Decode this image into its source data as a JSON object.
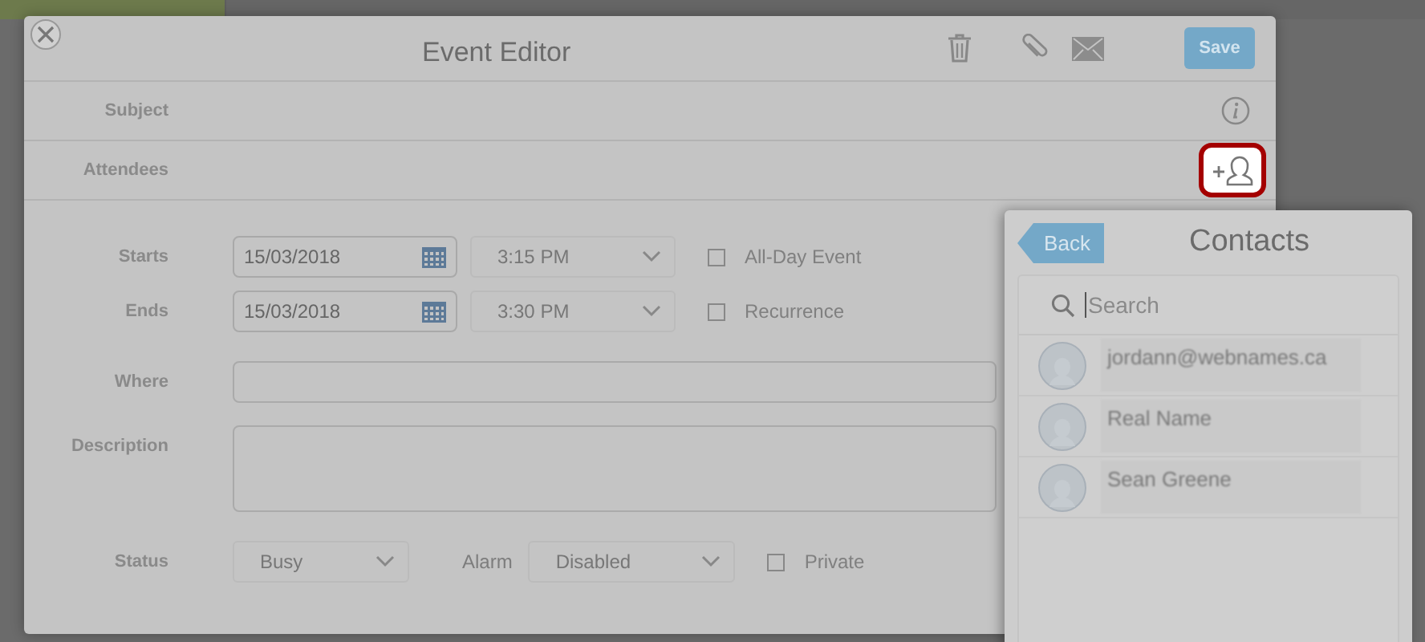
{
  "dialog": {
    "title": "Event Editor",
    "save": "Save",
    "rows": [
      {
        "label": "Subject"
      },
      {
        "label": "Attendees"
      }
    ],
    "schedule": [
      {
        "label": "Starts",
        "date": "15/03/2018",
        "time": "3:15 PM",
        "option": "All-Day Event",
        "checked": false
      },
      {
        "label": "Ends",
        "date": "15/03/2018",
        "time": "3:30 PM",
        "option": "Recurrence",
        "checked": false
      }
    ],
    "where": {
      "label": "Where"
    },
    "description": {
      "label": "Description"
    },
    "status": {
      "label": "Status",
      "value": "Busy"
    },
    "alarm": {
      "label": "Alarm",
      "value": "Disabled"
    },
    "private": {
      "label": "Private",
      "checked": false
    }
  },
  "contacts": {
    "back": "Back",
    "title": "Contacts",
    "placeholder": "Search",
    "items": [
      {
        "name": "jordann@webnames.ca"
      },
      {
        "name": "Real Name"
      },
      {
        "name": "Sean Greene"
      }
    ]
  }
}
